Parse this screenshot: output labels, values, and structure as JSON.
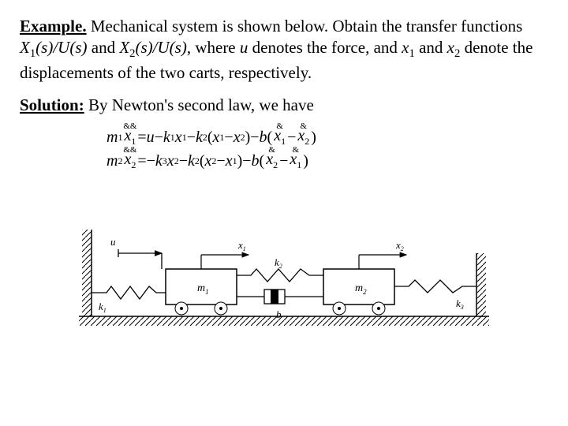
{
  "text": {
    "example_label": "Example.",
    "problem": " Mechanical system is shown below. Obtain the transfer functions ",
    "tf1_a": "X",
    "tf1_b": "(s)/U(s)",
    "and": " and ",
    "tf2_a": "X",
    "tf2_b": "(s)/U(s)",
    "where": ", where ",
    "u": "u",
    "denotes": " denotes the force, and ",
    "x1": "x",
    "x2": "x",
    "andx": " and ",
    "denote2": " denote the displacements of the two carts, respectively.",
    "solution_label": "Solution:",
    "solution_text": " By Newton's second law, we have"
  },
  "eqn": {
    "m": "m",
    "x": "x",
    "eq": " = ",
    "u": "u",
    "minus": " − ",
    "plus": " + ",
    "k": "k",
    "b": "b",
    "lp": "(",
    "rp": ")"
  },
  "diag": {
    "u": "u",
    "x1": "x",
    "x2": "x",
    "m1": "m",
    "m2": "m",
    "k1": "k",
    "k2": "k",
    "k3": "k",
    "b": "b",
    "sub1": "1",
    "sub2": "2",
    "sub3": "3"
  }
}
